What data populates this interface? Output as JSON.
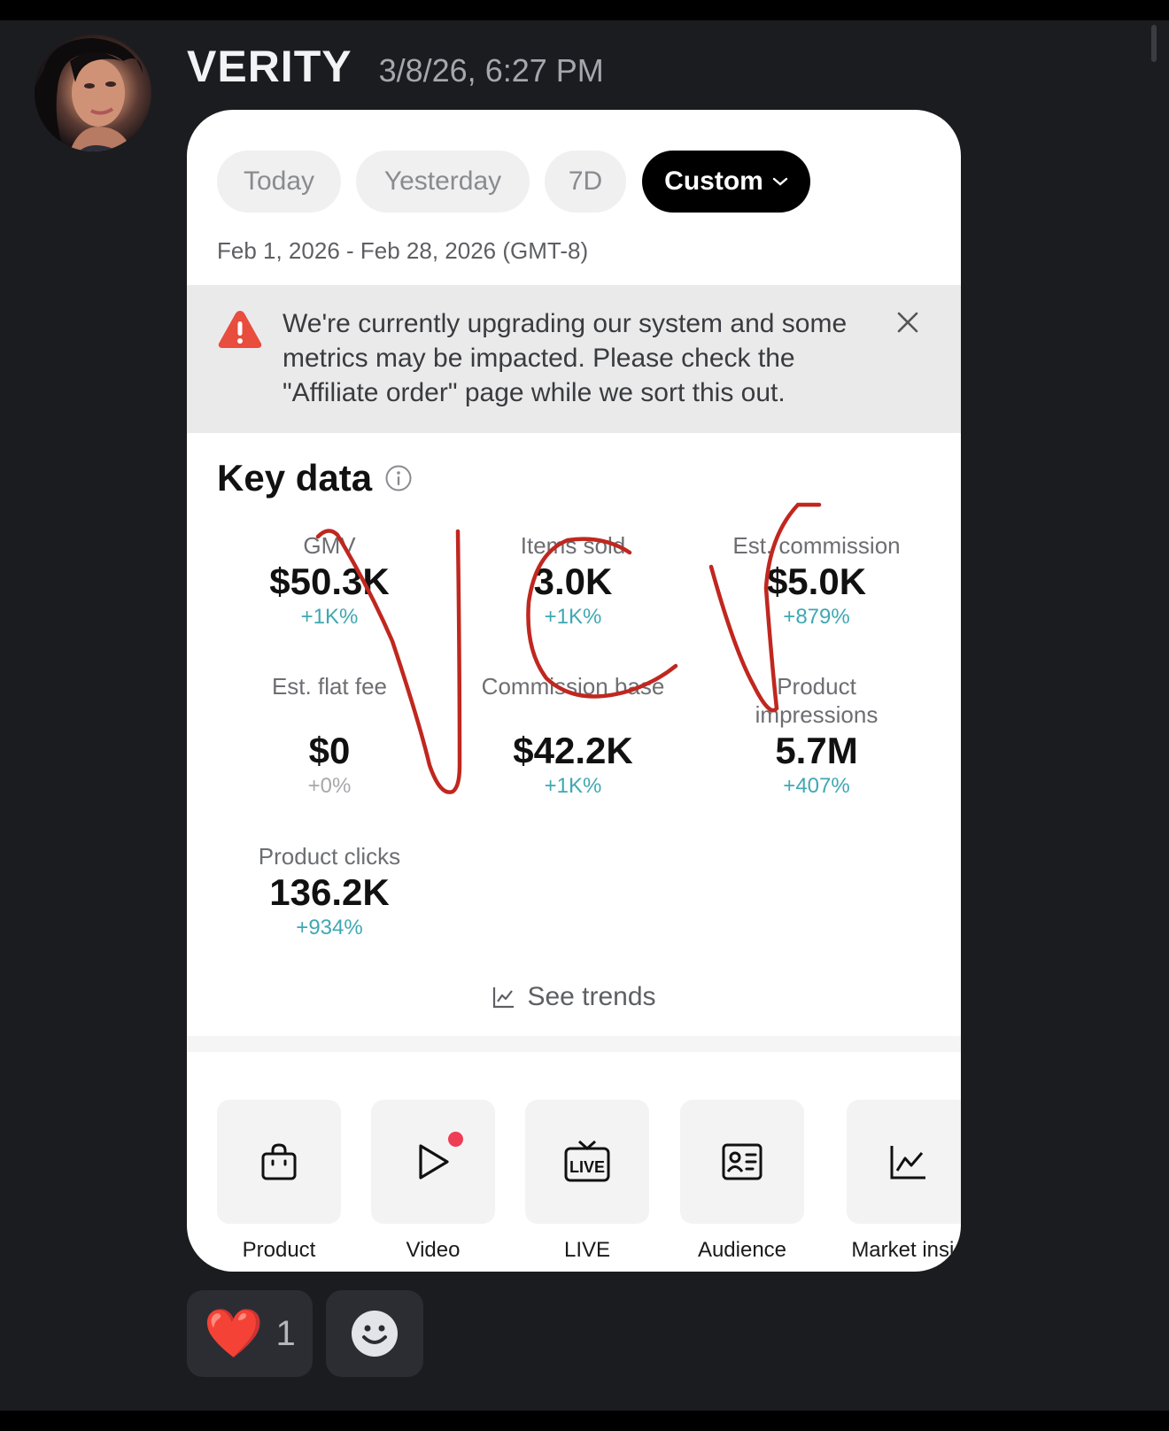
{
  "message": {
    "author": "VERITY",
    "timestamp": "3/8/26, 6:27 PM"
  },
  "card": {
    "tabs": [
      {
        "label": "Today",
        "active": false
      },
      {
        "label": "Yesterday",
        "active": false
      },
      {
        "label": "7D",
        "active": false
      },
      {
        "label": "Custom",
        "active": true
      }
    ],
    "date_range": "Feb 1, 2026 - Feb 28, 2026 (GMT-8)",
    "banner": {
      "text": "We're currently upgrading our system and some metrics may be impacted. Please check the \"Affiliate order\" page while we sort this out."
    },
    "key_data": {
      "title": "Key data",
      "metrics": [
        {
          "label": "GMV",
          "value": "$50.3K",
          "delta": "+1K%"
        },
        {
          "label": "Items sold",
          "value": "3.0K",
          "delta": "+1K%"
        },
        {
          "label": "Est. commission",
          "value": "$5.0K",
          "delta": "+879%"
        },
        {
          "label": "Est. flat fee",
          "value": "$0",
          "delta": "+0%"
        },
        {
          "label": "Commission base",
          "value": "$42.2K",
          "delta": "+1K%"
        },
        {
          "label": "Product impressions",
          "value": "5.7M",
          "delta": "+407%"
        },
        {
          "label": "Product clicks",
          "value": "136.2K",
          "delta": "+934%"
        }
      ],
      "see_trends": "See trends"
    },
    "tools": [
      {
        "label": "Product",
        "icon": "shopping-bag-icon"
      },
      {
        "label": "Video",
        "icon": "play-icon"
      },
      {
        "label": "LIVE",
        "icon": "live-tv-icon"
      },
      {
        "label": "Audience",
        "icon": "id-card-icon"
      },
      {
        "label": "Market insig",
        "icon": "line-chart-icon"
      }
    ],
    "live_icon_text": "LIVE"
  },
  "reactions": [
    {
      "emoji": "❤️",
      "count": "1"
    }
  ],
  "colors": {
    "background": "#1b1c20",
    "accent_delta": "#3fa8b4",
    "warning": "#e84d3d",
    "annotation_ink": "#c0271f"
  }
}
